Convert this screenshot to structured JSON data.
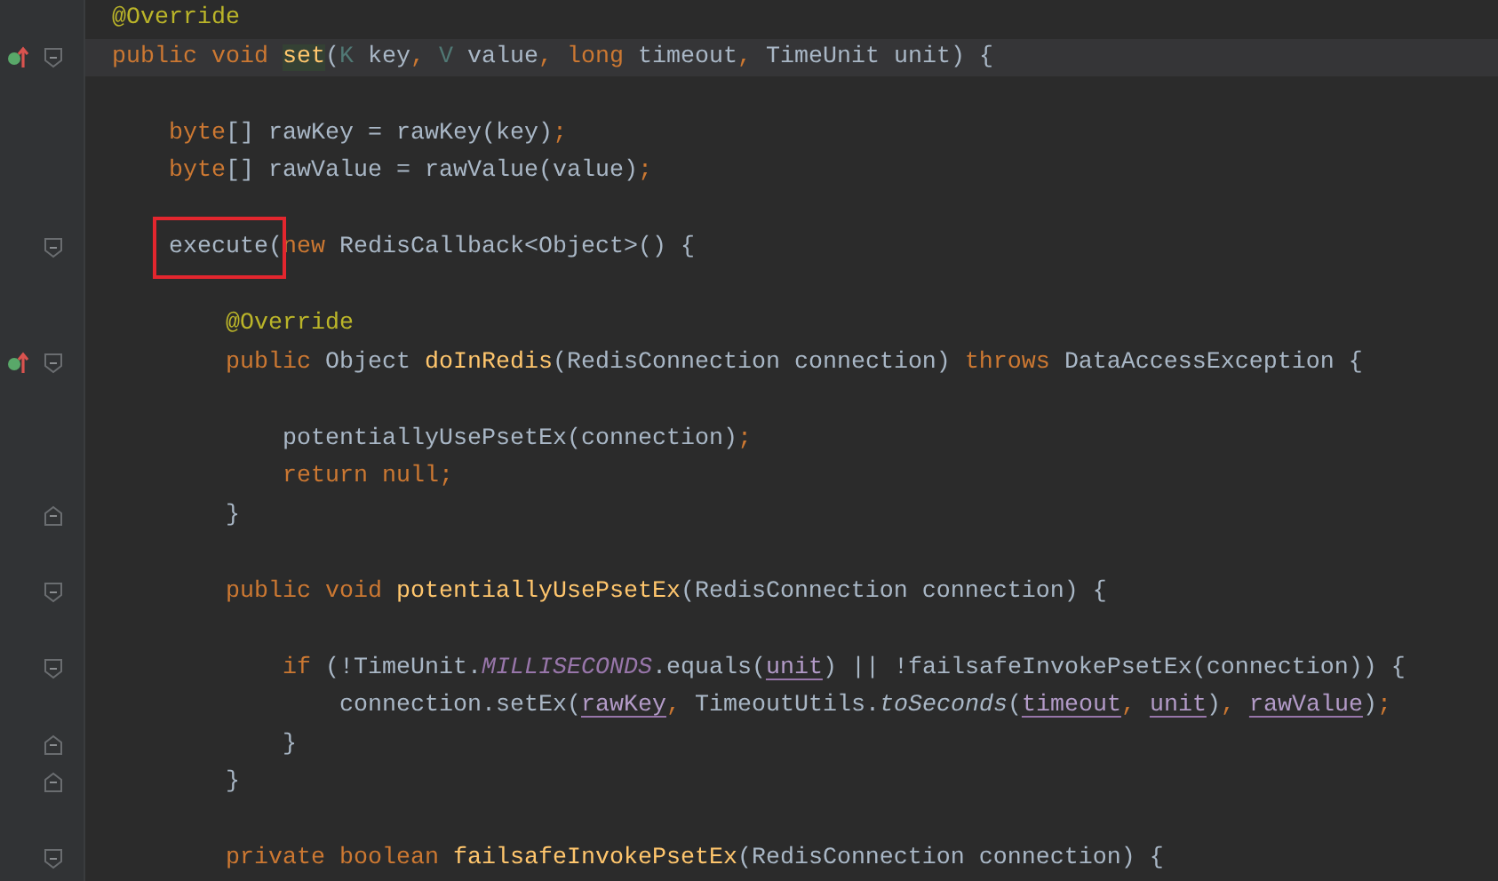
{
  "editor": {
    "lines": [
      {
        "current": false,
        "overrides": false,
        "folding": false,
        "words": [
          [
            {
              "kind": "annotation",
              "text": "@Override"
            }
          ]
        ]
      },
      {
        "current": true,
        "overrides": true,
        "folding": true,
        "words": [
          [
            {
              "kind": "keyword",
              "text": "public"
            }
          ],
          [
            {
              "kind": "keyword",
              "text": "void"
            }
          ],
          [
            {
              "kind": "declaration-hit",
              "text": "set"
            },
            {
              "kind": "plain",
              "text": "("
            },
            {
              "kind": "type-param",
              "text": "K"
            }
          ],
          [
            {
              "kind": "plain",
              "text": "key"
            },
            {
              "kind": "punct",
              "text": ","
            }
          ],
          [
            {
              "kind": "type-param",
              "text": "V"
            }
          ],
          [
            {
              "kind": "plain",
              "text": "value"
            },
            {
              "kind": "punct",
              "text": ","
            }
          ],
          [
            {
              "kind": "keyword",
              "text": "long"
            }
          ],
          [
            {
              "kind": "plain",
              "text": "timeout"
            },
            {
              "kind": "punct",
              "text": ","
            }
          ],
          [
            {
              "kind": "plain",
              "text": "TimeUnit unit) {"
            }
          ]
        ],
        "children": [
          {
            "current": false,
            "overrides": false,
            "folding": false
          },
          {
            "current": false,
            "overrides": false,
            "folding": false,
            "words": [
              [
                {
                  "kind": "keyword",
                  "text": "byte"
                },
                {
                  "kind": "plain",
                  "text": "[] rawKey = rawKey(key)"
                },
                {
                  "kind": "punct",
                  "text": ";"
                }
              ]
            ]
          },
          {
            "current": false,
            "overrides": false,
            "folding": false,
            "words": [
              [
                {
                  "kind": "keyword",
                  "text": "byte"
                },
                {
                  "kind": "plain",
                  "text": "[] rawValue = rawValue(value)"
                },
                {
                  "kind": "punct",
                  "text": ";"
                }
              ]
            ]
          },
          {
            "current": false,
            "overrides": false,
            "folding": false
          },
          {
            "current": false,
            "overrides": false,
            "folding": true,
            "words": [
              [
                {
                  "kind": "boxed",
                  "text": "execute("
                },
                {
                  "kind": "keyword",
                  "text": "new"
                }
              ],
              [
                {
                  "kind": "plain",
                  "text": "RedisCallback<Object>() {"
                }
              ]
            ],
            "children": [
              {
                "current": false,
                "overrides": false,
                "folding": false
              },
              {
                "current": false,
                "overrides": false,
                "folding": false,
                "words": [
                  [
                    {
                      "kind": "annotation",
                      "text": "@Override"
                    }
                  ]
                ]
              },
              {
                "current": false,
                "overrides": true,
                "folding": true,
                "words": [
                  [
                    {
                      "kind": "keyword",
                      "text": "public"
                    }
                  ],
                  [
                    {
                      "kind": "plain",
                      "text": "Object"
                    }
                  ],
                  [
                    {
                      "kind": "declaration",
                      "text": "doInRedis"
                    },
                    {
                      "kind": "plain",
                      "text": "(RedisConnection connection)"
                    }
                  ],
                  [
                    {
                      "kind": "keyword",
                      "text": "throws"
                    }
                  ],
                  [
                    {
                      "kind": "plain",
                      "text": "DataAccessException {"
                    }
                  ]
                ],
                "children": [
                  {
                    "current": false,
                    "overrides": false,
                    "folding": false
                  },
                  {
                    "current": false,
                    "overrides": false,
                    "folding": false,
                    "words": [
                      [
                        {
                          "kind": "plain",
                          "text": "potentiallyUsePsetEx(connection)"
                        },
                        {
                          "kind": "punct",
                          "text": ";"
                        }
                      ]
                    ]
                  },
                  {
                    "current": false,
                    "overrides": false,
                    "folding": false,
                    "words": [
                      [
                        {
                          "kind": "keyword",
                          "text": "return null;"
                        }
                      ]
                    ]
                  }
                ],
                "end": [
                  [
                    {
                      "kind": "plain",
                      "text": "}"
                    }
                  ]
                ]
              },
              {
                "current": false,
                "overrides": false,
                "folding": false
              },
              {
                "current": false,
                "overrides": false,
                "folding": true,
                "words": [
                  [
                    {
                      "kind": "keyword",
                      "text": "public void"
                    }
                  ],
                  [
                    {
                      "kind": "declaration",
                      "text": "potentiallyUsePsetEx"
                    },
                    {
                      "kind": "plain",
                      "text": "(RedisConnection connection) {"
                    }
                  ]
                ],
                "children": [
                  {
                    "current": false,
                    "overrides": false,
                    "folding": false
                  },
                  {
                    "current": false,
                    "overrides": false,
                    "folding": true,
                    "words": [
                      [
                        {
                          "kind": "keyword",
                          "text": "if"
                        }
                      ],
                      [
                        {
                          "kind": "plain",
                          "text": "(!TimeUnit."
                        },
                        {
                          "kind": "static",
                          "text": "MILLISECONDS"
                        },
                        {
                          "kind": "plain",
                          "text": ".equals("
                        },
                        {
                          "kind": "captured",
                          "text": "unit"
                        },
                        {
                          "kind": "plain",
                          "text": ") || !failsafeInvokePsetEx(connection)) {"
                        }
                      ]
                    ],
                    "children": [
                      {
                        "current": false,
                        "overrides": false,
                        "folding": false,
                        "words": [
                          [
                            {
                              "kind": "plain",
                              "text": "connection.setEx("
                            },
                            {
                              "kind": "captured",
                              "text": "rawKey"
                            },
                            {
                              "kind": "punct",
                              "text": ","
                            }
                          ],
                          [
                            {
                              "kind": "plain",
                              "text": "TimeoutUtils."
                            },
                            {
                              "kind": "italic",
                              "text": "toSeconds"
                            },
                            {
                              "kind": "plain",
                              "text": "("
                            },
                            {
                              "kind": "captured",
                              "text": "timeout"
                            },
                            {
                              "kind": "punct",
                              "text": ","
                            }
                          ],
                          [
                            {
                              "kind": "captured",
                              "text": "unit"
                            },
                            {
                              "kind": "plain",
                              "text": ")"
                            },
                            {
                              "kind": "punct",
                              "text": ","
                            }
                          ],
                          [
                            {
                              "kind": "captured",
                              "text": "rawValue"
                            },
                            {
                              "kind": "plain",
                              "text": ")"
                            },
                            {
                              "kind": "punct",
                              "text": ";"
                            }
                          ]
                        ]
                      }
                    ],
                    "end": [
                      [
                        {
                          "kind": "plain",
                          "text": "}"
                        }
                      ]
                    ]
                  }
                ],
                "end": [
                  [
                    {
                      "kind": "plain",
                      "text": "}"
                    }
                  ]
                ]
              },
              {
                "current": false,
                "overrides": false,
                "folding": false
              },
              {
                "current": false,
                "overrides": false,
                "folding": true,
                "words": [
                  [
                    {
                      "kind": "keyword",
                      "text": "private boolean"
                    }
                  ],
                  [
                    {
                      "kind": "declaration",
                      "text": "failsafeInvokePsetEx"
                    },
                    {
                      "kind": "plain",
                      "text": "(RedisConnection connection) {"
                    }
                  ]
                ]
              }
            ]
          }
        ]
      }
    ]
  }
}
